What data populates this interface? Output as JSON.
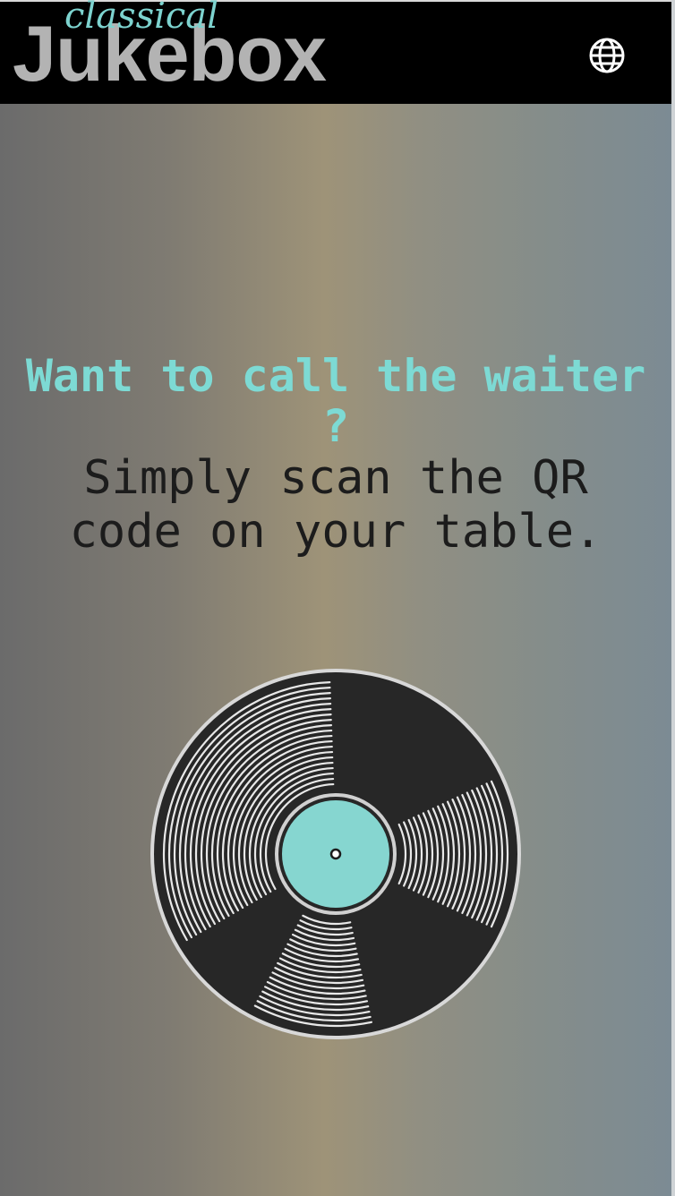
{
  "header": {
    "logo_script": "classical",
    "logo_main": "Jukebox",
    "language_icon": "globe-icon"
  },
  "main": {
    "headline_accent": "Want to call the waiter ?",
    "headline_body": "Simply scan the QR code on your table.",
    "record_icon": "vinyl-record-icon"
  },
  "colors": {
    "accent": "#7ddad4",
    "header_bg": "#000000",
    "logo_text": "#b3b3b3",
    "body_text": "#1c1c1c"
  }
}
